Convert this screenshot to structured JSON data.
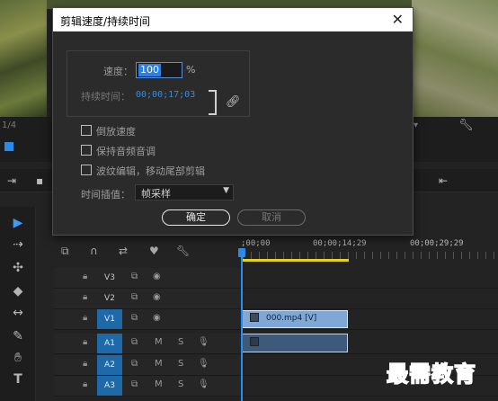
{
  "dialog": {
    "title": "剪辑速度/持续时间",
    "close_glyph": "✕",
    "speed_label": "速度：",
    "speed_value": "100",
    "speed_unit": "%",
    "duration_label": "持续时间：",
    "duration_value": "00;00;17;03",
    "options": [
      {
        "label": "倒放速度",
        "checked": false
      },
      {
        "label": "保持音频音调",
        "checked": false
      },
      {
        "label": "波纹编辑，移动尾部剪辑",
        "checked": false
      }
    ],
    "interpolation_label": "时间插值：",
    "interpolation_value": "帧采样",
    "ok_label": "确定",
    "cancel_label": "取消"
  },
  "monitor": {
    "fraction_text": "1/4"
  },
  "timeline": {
    "timecodes": [
      ";00;00",
      "00;00;14;29",
      "00;00;29;29"
    ],
    "tracks": [
      {
        "name": "V3",
        "type": "video",
        "active": false
      },
      {
        "name": "V2",
        "type": "video",
        "active": false
      },
      {
        "name": "V1",
        "type": "video",
        "active": true
      },
      {
        "name": "A1",
        "type": "audio",
        "active": true
      },
      {
        "name": "A2",
        "type": "audio",
        "active": true
      },
      {
        "name": "A3",
        "type": "audio",
        "active": true
      }
    ],
    "audio_m": "M",
    "audio_s": "S",
    "video_clip_label": "000.mp4 [V]"
  },
  "tools": [
    "selection-tool",
    "track-select-tool",
    "ripple-edit-tool",
    "razor-tool",
    "slip-tool",
    "pen-tool",
    "hand-tool",
    "type-tool"
  ],
  "watermark": "最需教育",
  "colors": {
    "accent": "#2d8ceb",
    "track_active": "#1e6aa8",
    "clip_video": "#7fa8d6",
    "clip_audio": "#3e5a7a",
    "ruler_inout": "#e6d21a"
  }
}
